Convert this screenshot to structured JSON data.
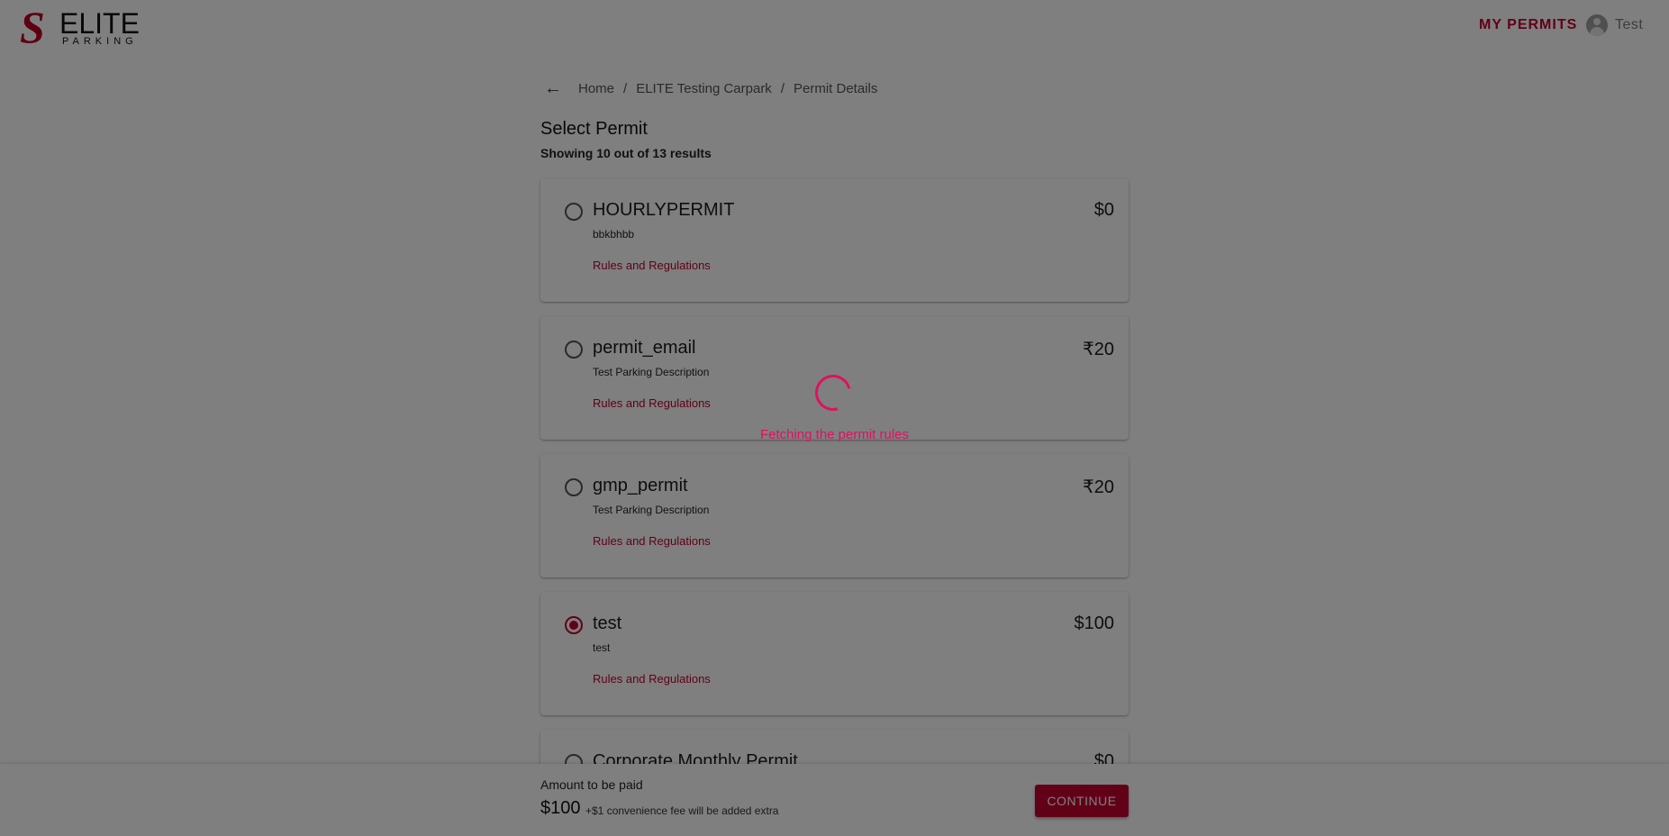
{
  "header": {
    "logo_s": "S",
    "logo_elite": "ELITE",
    "logo_parking": "PARKING",
    "my_permits": "MY PERMITS",
    "user_name": "Test"
  },
  "breadcrumb": {
    "items": [
      "Home",
      "ELITE Testing Carpark",
      "Permit Details"
    ],
    "separator": "/"
  },
  "page": {
    "title": "Select Permit",
    "subtitle": "Showing 10 out of 13 results"
  },
  "permits": [
    {
      "name": "HOURLYPERMIT",
      "price": "$0",
      "description": "bbkbhbb",
      "link": "Rules and Regulations",
      "selected": false
    },
    {
      "name": "permit_email",
      "price": "₹20",
      "description": "Test Parking Description",
      "link": "Rules and Regulations",
      "selected": false
    },
    {
      "name": "gmp_permit",
      "price": "₹20",
      "description": "Test Parking Description",
      "link": "Rules and Regulations",
      "selected": false
    },
    {
      "name": "test",
      "price": "$100",
      "description": "test",
      "link": "Rules and Regulations",
      "selected": true
    },
    {
      "name": "Corporate Monthly Permit",
      "price": "$0",
      "description": "",
      "link": "",
      "selected": false
    }
  ],
  "footer": {
    "amount_label": "Amount to be paid",
    "amount_value": "$100",
    "amount_note": "+$1 convenience fee will be added extra",
    "continue_label": "CONTINUE"
  },
  "loading": {
    "text": "Fetching the permit rules"
  },
  "colors": {
    "accent": "#c3002f",
    "loader": "#e0115f"
  }
}
